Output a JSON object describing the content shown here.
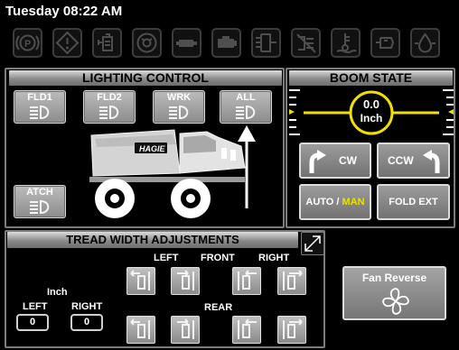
{
  "header": {
    "datetime": "Tuesday 08:22 AM"
  },
  "warning_icons": [
    "parking-brake-icon",
    "warning-icon",
    "hydraulic-filter-icon",
    "transmission-icon",
    "engine-oil-icon",
    "engine-icon",
    "air-filter-icon",
    "regen-inhibit-icon",
    "coolant-temp-icon",
    "fuel-filter-icon",
    "hydraulic-oil-icon"
  ],
  "lighting": {
    "title": "LIGHTING CONTROL",
    "buttons": {
      "fld1": "FLD1",
      "fld2": "FLD2",
      "wrk": "WRK",
      "all": "ALL",
      "atch": "ATCH"
    },
    "machine_logo": "HAGIE"
  },
  "boom": {
    "title": "BOOM STATE",
    "gauge_value": "0.0",
    "gauge_unit": "Inch",
    "cw": "CW",
    "ccw": "CCW",
    "auto": "AUTO",
    "slash": " / ",
    "man": "MAN",
    "fold_ext": "FOLD EXT"
  },
  "tread": {
    "title": "TREAD WIDTH ADJUSTMENTS",
    "unit": "Inch",
    "left": "LEFT",
    "right": "RIGHT",
    "left_value": "0",
    "right_value": "0",
    "front": "FRONT",
    "rear": "REAR",
    "front_left": "LEFT",
    "front_right": "RIGHT"
  },
  "fan": {
    "label": "Fan Reverse"
  },
  "colors": {
    "accent_yellow": "#f0e000",
    "panel_border": "#7c7c7c",
    "button_gray": "#8c8c8c"
  }
}
